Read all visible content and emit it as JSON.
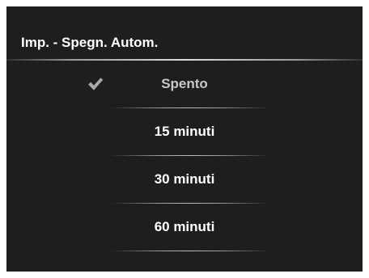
{
  "header": {
    "title": "Imp. - Spegn. Autom."
  },
  "options": [
    {
      "label": "Spento",
      "selected": true,
      "icon": "check-icon"
    },
    {
      "label": "15 minuti",
      "selected": false
    },
    {
      "label": "30 minuti",
      "selected": false
    },
    {
      "label": "60 minuti",
      "selected": false
    }
  ],
  "colors": {
    "background": "#1e1e1e",
    "text": "#ffffff",
    "selected_text": "#c8c8c8",
    "check": "#a8a8a8"
  }
}
